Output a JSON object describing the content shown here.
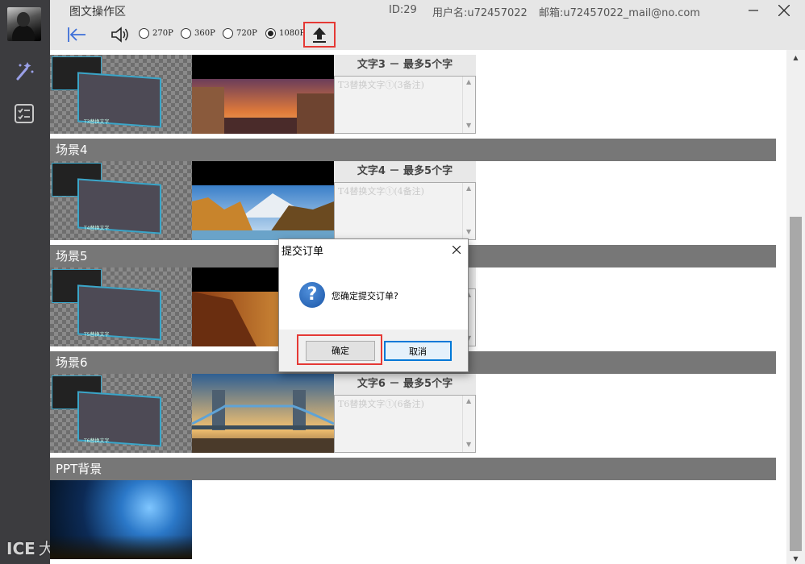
{
  "window": {
    "title": "图文操作区",
    "id_text": "ID:29",
    "username_text": "用户名:u72457022",
    "email_text": "邮箱:u72457022_mail@no.com"
  },
  "toolbar": {
    "resolutions": [
      {
        "label": "270P",
        "selected": false
      },
      {
        "label": "360P",
        "selected": false
      },
      {
        "label": "720P",
        "selected": false
      },
      {
        "label": "1080P",
        "selected": true
      }
    ]
  },
  "scenes": [
    {
      "header": "",
      "label": "文字3 － 最多5个字",
      "placeholder": "T3替换文字①(3备注)",
      "thumb_label": "T3替换文字"
    },
    {
      "header": "场景4",
      "label": "文字4 － 最多5个字",
      "placeholder": "T4替换文字①(4备注)",
      "thumb_label": "T4替换文字"
    },
    {
      "header": "场景5",
      "label": "",
      "placeholder": "",
      "thumb_label": "T5替换文字"
    },
    {
      "header": "场景6",
      "label": "文字6 － 最多5个字",
      "placeholder": "T6替换文字①(6备注)",
      "thumb_label": "T6替换文字"
    }
  ],
  "ppt": {
    "header": "PPT背景"
  },
  "dialog": {
    "title": "提交订单",
    "message": "您确定提交订单?",
    "ok_label": "确定",
    "cancel_label": "取消"
  },
  "watermark": {
    "logo": "ICE",
    "text": "大数据境"
  },
  "colors": {
    "accent_red": "#e53935",
    "header_gray": "#777777",
    "rail": "#3c3c3f",
    "dialog_blue": "#0078d7"
  }
}
